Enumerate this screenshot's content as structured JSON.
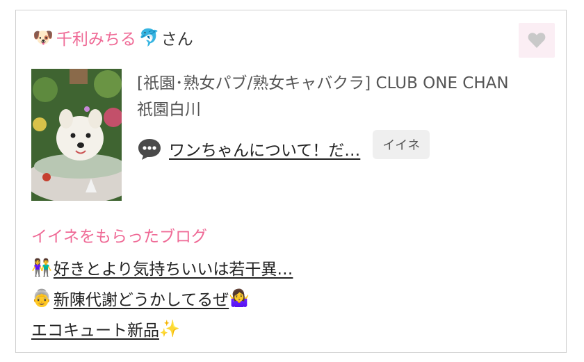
{
  "colors": {
    "accent": "#ef6a96",
    "like_bg": "#fbeef4",
    "heart": "#c9c9c9"
  },
  "header": {
    "lead_emoji": "🐶",
    "name": "千利みちる",
    "trail_emoji": "🐬",
    "suffix": "さん",
    "like_icon": "heart-icon"
  },
  "shop": {
    "line1": "[祇園･熟女パブ/熟女キャバクラ]  CLUB ONE CHAN",
    "line2": "祇園白川"
  },
  "topic": {
    "icon": "speech-bubble-icon",
    "title": "ワンちゃんについて！だ…",
    "iine_label": "イイネ"
  },
  "blogs": {
    "heading": "イイネをもらったブログ",
    "items": [
      {
        "lead": "👫",
        "text": "好きとより気持ちいいは若干異…",
        "trail": ""
      },
      {
        "lead": "👵",
        "text": "新陳代謝どうかしてるぜ",
        "trail": "🤷‍♀️"
      },
      {
        "lead": "",
        "text": "エコキュート新品",
        "trail": "✨"
      }
    ]
  }
}
